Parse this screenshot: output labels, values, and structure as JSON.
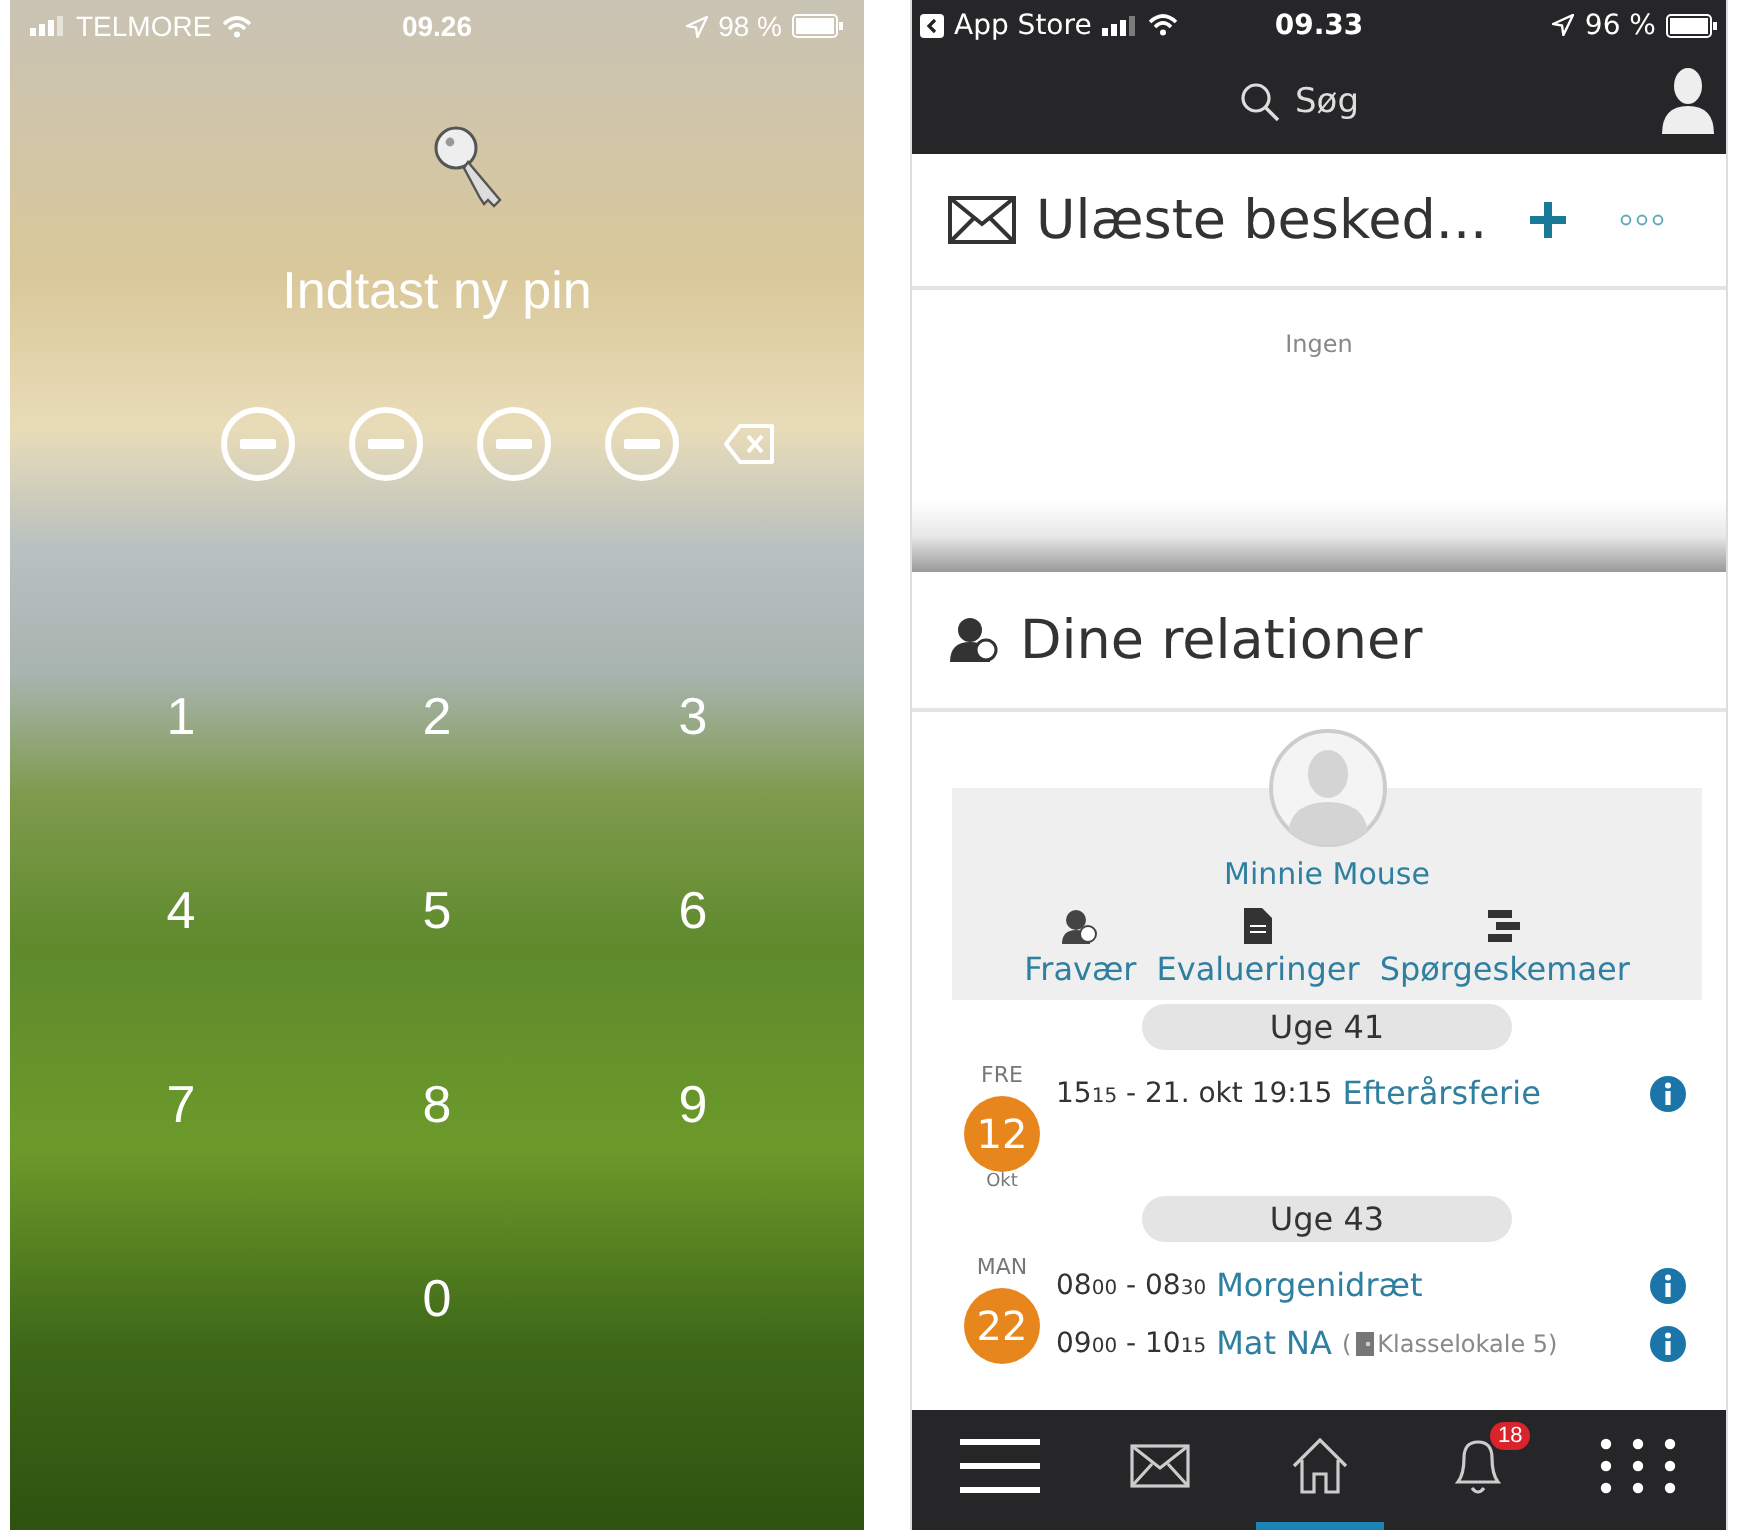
{
  "pin_screen": {
    "status_bar": {
      "carrier": "TELMORE",
      "time": "09.26",
      "battery": "98 %"
    },
    "prompt": "Indtast ny pin",
    "pin_slots": [
      {
        "filled": false
      },
      {
        "filled": false
      },
      {
        "filled": false
      },
      {
        "filled": false
      }
    ],
    "keys": [
      "1",
      "2",
      "3",
      "4",
      "5",
      "6",
      "7",
      "8",
      "9",
      "0"
    ]
  },
  "app_screen": {
    "status_bar": {
      "back_app": "App Store",
      "time": "09.33",
      "battery": "96 %"
    },
    "search": {
      "placeholder": "Søg"
    },
    "messages": {
      "title": "Ulæste besked...",
      "empty_text": "Ingen"
    },
    "relations": {
      "title": "Dine relationer",
      "name": "Minnie Mouse",
      "links": [
        {
          "kind": "absence",
          "label": "Fravær"
        },
        {
          "kind": "evaluation",
          "label": "Evalueringer"
        },
        {
          "kind": "survey",
          "label": "Spørgeskemaer"
        }
      ],
      "calendar": [
        {
          "kind": "week",
          "label": "Uge 41"
        },
        {
          "kind": "day",
          "weekday": "FRE",
          "day": "12",
          "month": "Okt",
          "events": [
            {
              "time": {
                "start": [
                  "15",
                  "15"
                ],
                "separator": "- ",
                "end_text": "21. okt 19:15"
              },
              "title": "Efterårsferie"
            }
          ]
        },
        {
          "kind": "week",
          "label": "Uge 43"
        },
        {
          "kind": "day",
          "weekday": "MAN",
          "day": "22",
          "events": [
            {
              "time": {
                "start": [
                  "08",
                  "00"
                ],
                "separator": "- ",
                "end": [
                  "08",
                  "30"
                ]
              },
              "title": "Morgenidræt"
            },
            {
              "time": {
                "start": [
                  "09",
                  "00"
                ],
                "separator": "- ",
                "end": [
                  "10",
                  "15"
                ]
              },
              "title": "Mat NA",
              "location_open": "(",
              "location": "Klasselokale 5)"
            }
          ]
        }
      ]
    },
    "bottom_nav": [
      {
        "kind": "menu",
        "selected": false
      },
      {
        "kind": "mail",
        "selected": false
      },
      {
        "kind": "home",
        "selected": true
      },
      {
        "kind": "bell",
        "selected": false,
        "badge": "18"
      },
      {
        "kind": "apps",
        "selected": false
      }
    ]
  }
}
